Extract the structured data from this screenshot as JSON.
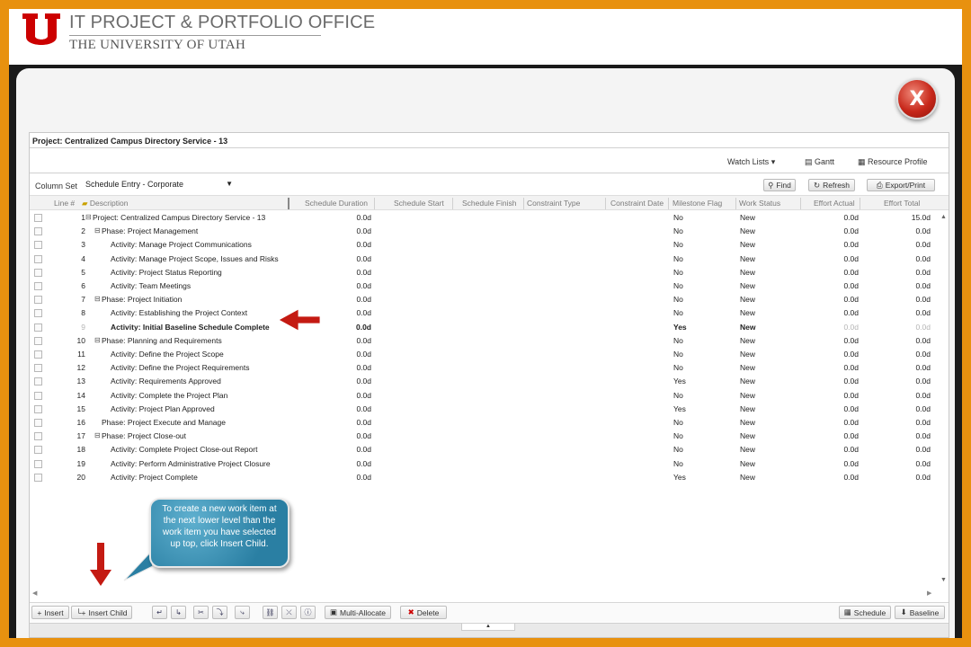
{
  "header": {
    "title_line1": "IT PROJECT & PORTFOLIO OFFICE",
    "title_line2": "THE UNIVERSITY OF UTAH"
  },
  "colors": {
    "frame": "#e8910f",
    "logo_red": "#cc0000",
    "callout": "#2a7fa3",
    "arrow_red": "#c41a12"
  },
  "close_button": {
    "label": "X"
  },
  "project": {
    "title": "Project: Centralized Campus Directory Service - 13"
  },
  "toolbar": {
    "watch_lists": "Watch Lists",
    "gantt": "Gantt",
    "resource_profile": "Resource Profile",
    "column_set_label": "Column Set",
    "column_set_value": "Schedule Entry - Corporate",
    "find": "Find",
    "refresh": "Refresh",
    "export_print": "Export/Print"
  },
  "columns": [
    "Line #",
    "Description",
    "Schedule Duration",
    "Schedule Start",
    "Schedule Finish",
    "Constraint Type",
    "Constraint Date",
    "Milestone Flag",
    "Work Status",
    "Effort Actual",
    "Effort Total"
  ],
  "rows": [
    {
      "line": "1",
      "level": 0,
      "toggle": "⊟",
      "desc": "Project: Centralized Campus Directory Service - 13",
      "dur": "0.0d",
      "ms": "No",
      "ws": "New",
      "ea": "0.0d",
      "et": "15.0d"
    },
    {
      "line": "2",
      "level": 1,
      "toggle": "⊟",
      "desc": "Phase: Project Management",
      "dur": "0.0d",
      "ms": "No",
      "ws": "New",
      "ea": "0.0d",
      "et": "0.0d"
    },
    {
      "line": "3",
      "level": 2,
      "toggle": "",
      "desc": "Activity: Manage Project Communications",
      "dur": "0.0d",
      "ms": "No",
      "ws": "New",
      "ea": "0.0d",
      "et": "0.0d"
    },
    {
      "line": "4",
      "level": 2,
      "toggle": "",
      "desc": "Activity: Manage Project Scope, Issues and Risks",
      "dur": "0.0d",
      "ms": "No",
      "ws": "New",
      "ea": "0.0d",
      "et": "0.0d"
    },
    {
      "line": "5",
      "level": 2,
      "toggle": "",
      "desc": "Activity: Project Status Reporting",
      "dur": "0.0d",
      "ms": "No",
      "ws": "New",
      "ea": "0.0d",
      "et": "0.0d"
    },
    {
      "line": "6",
      "level": 2,
      "toggle": "",
      "desc": "Activity: Team Meetings",
      "dur": "0.0d",
      "ms": "No",
      "ws": "New",
      "ea": "0.0d",
      "et": "0.0d"
    },
    {
      "line": "7",
      "level": 1,
      "toggle": "⊟",
      "desc": "Phase: Project Initiation",
      "dur": "0.0d",
      "ms": "No",
      "ws": "New",
      "ea": "0.0d",
      "et": "0.0d"
    },
    {
      "line": "8",
      "level": 2,
      "toggle": "",
      "desc": "Activity: Establishing the Project Context",
      "dur": "0.0d",
      "ms": "No",
      "ws": "New",
      "ea": "0.0d",
      "et": "0.0d"
    },
    {
      "line": "9",
      "level": 2,
      "toggle": "",
      "desc": "Activity: Initial Baseline Schedule Complete",
      "dur": "0.0d",
      "ms": "Yes",
      "ws": "New",
      "ea": "0.0d",
      "et": "0.0d",
      "bold": true
    },
    {
      "line": "10",
      "level": 1,
      "toggle": "⊟",
      "desc": "Phase: Planning and Requirements",
      "dur": "0.0d",
      "ms": "No",
      "ws": "New",
      "ea": "0.0d",
      "et": "0.0d"
    },
    {
      "line": "11",
      "level": 2,
      "toggle": "",
      "desc": "Activity: Define the Project Scope",
      "dur": "0.0d",
      "ms": "No",
      "ws": "New",
      "ea": "0.0d",
      "et": "0.0d"
    },
    {
      "line": "12",
      "level": 2,
      "toggle": "",
      "desc": "Activity: Define the Project Requirements",
      "dur": "0.0d",
      "ms": "No",
      "ws": "New",
      "ea": "0.0d",
      "et": "0.0d"
    },
    {
      "line": "13",
      "level": 2,
      "toggle": "",
      "desc": "Activity: Requirements Approved",
      "dur": "0.0d",
      "ms": "Yes",
      "ws": "New",
      "ea": "0.0d",
      "et": "0.0d"
    },
    {
      "line": "14",
      "level": 2,
      "toggle": "",
      "desc": "Activity: Complete the Project Plan",
      "dur": "0.0d",
      "ms": "No",
      "ws": "New",
      "ea": "0.0d",
      "et": "0.0d"
    },
    {
      "line": "15",
      "level": 2,
      "toggle": "",
      "desc": "Activity: Project Plan Approved",
      "dur": "0.0d",
      "ms": "Yes",
      "ws": "New",
      "ea": "0.0d",
      "et": "0.0d"
    },
    {
      "line": "16",
      "level": 1,
      "toggle": "",
      "desc": "Phase: Project Execute and Manage",
      "dur": "0.0d",
      "ms": "No",
      "ws": "New",
      "ea": "0.0d",
      "et": "0.0d"
    },
    {
      "line": "17",
      "level": 1,
      "toggle": "⊟",
      "desc": "Phase: Project Close-out",
      "dur": "0.0d",
      "ms": "No",
      "ws": "New",
      "ea": "0.0d",
      "et": "0.0d"
    },
    {
      "line": "18",
      "level": 2,
      "toggle": "",
      "desc": "Activity: Complete Project Close-out Report",
      "dur": "0.0d",
      "ms": "No",
      "ws": "New",
      "ea": "0.0d",
      "et": "0.0d"
    },
    {
      "line": "19",
      "level": 2,
      "toggle": "",
      "desc": "Activity: Perform Administrative Project Closure",
      "dur": "0.0d",
      "ms": "No",
      "ws": "New",
      "ea": "0.0d",
      "et": "0.0d"
    },
    {
      "line": "20",
      "level": 2,
      "toggle": "",
      "desc": "Activity: Project Complete",
      "dur": "0.0d",
      "ms": "Yes",
      "ws": "New",
      "ea": "0.0d",
      "et": "0.0d"
    }
  ],
  "bottom": {
    "insert": "Insert",
    "insert_child": "Insert Child",
    "multi_allocate": "Multi-Allocate",
    "delete": "Delete",
    "schedule": "Schedule",
    "baseline": "Baseline"
  },
  "callout": {
    "text": "To create a new work item at the next lower level than the work item you have selected up top, click Insert Child."
  }
}
